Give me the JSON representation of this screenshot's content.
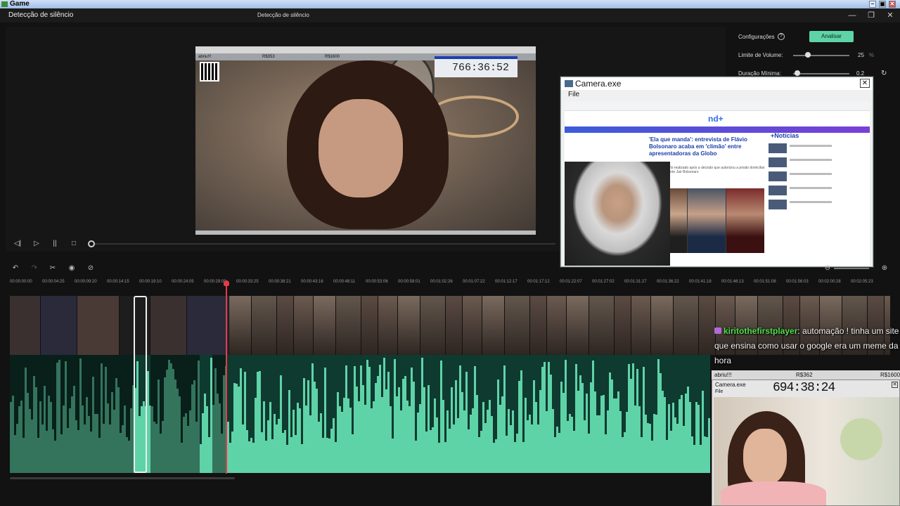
{
  "outer_window": {
    "title": "Game",
    "min": "–",
    "max": "▣",
    "close": "✕"
  },
  "app": {
    "title_left": "Detecção de silêncio",
    "title_center": "Detecção de silêncio",
    "min_icon": "—",
    "restore_icon": "❐",
    "close_icon": "✕"
  },
  "settings": {
    "config_label": "Configurações",
    "help_icon": "?",
    "analyze_button": "Analisar",
    "volume_label": "Limite de Volume:",
    "volume_value": "25",
    "volume_unit": "%",
    "duration_label": "Duração Mínima:",
    "duration_value": "0.2",
    "reset_icon": "↻"
  },
  "video_overlay": {
    "name": "abriu!!!",
    "mid": "R$353",
    "right": "R$1600",
    "timer": "766:36:52"
  },
  "transport": {
    "prev_frame": "◁|",
    "play": "▷",
    "pause": "||",
    "stop": "□"
  },
  "camera_window": {
    "title": "Camera.exe",
    "menu_file": "File",
    "close": "✕",
    "site_logo": "nd+",
    "headline": "'Ela que manda': entrevista de Flávio Bolsonaro acaba em 'climão' entre apresentadoras da Globo",
    "subhead": "O bate-papo foi realizado após a decisão que autorizou a prisão domiciliar do ex-presidente Jair Bolsonaro",
    "noticias": "+Notícias"
  },
  "toolbar": {
    "undo": "↶",
    "redo": "↷",
    "cut": "✂",
    "show": "◉",
    "hide": "⊘",
    "zoom_out": "⊖",
    "zoom_in": "⊕"
  },
  "ruler_ticks": [
    "00:00:00:00",
    "00:00:04:25",
    "00:00:09:20",
    "00:00:14:15",
    "00:00:19:10",
    "00:00:24:05",
    "00:00:29:00",
    "00:00:33:25",
    "00:00:38:21",
    "00:00:43:16",
    "00:00:48:11",
    "00:00:53:06",
    "00:00:58:01",
    "00:01:02:26",
    "00:01:07:22",
    "00:01:12:17",
    "00:01:17:12",
    "00:01:22:07",
    "00:01:27:02",
    "00:01:31:27",
    "00:01:36:22",
    "00:01:41:18",
    "00:01:46:13",
    "00:01:51:08",
    "00:01:56:03",
    "00:02:00:28",
    "00:02:05:23"
  ],
  "chat": {
    "user": "kiritothefirstplayer",
    "message": ": automação ! tinha um site que ensina como usar o google era um meme da hora"
  },
  "overlay2": {
    "name": "abriu!!!",
    "mid": "R$362",
    "right": "R$1600",
    "title": "Camera.exe",
    "file": "File",
    "timer": "694:38:24",
    "close": "✕"
  },
  "colors": {
    "accent": "#5fd3a8",
    "playhead": "#e23c4a",
    "chat_user": "#4fe04f"
  }
}
